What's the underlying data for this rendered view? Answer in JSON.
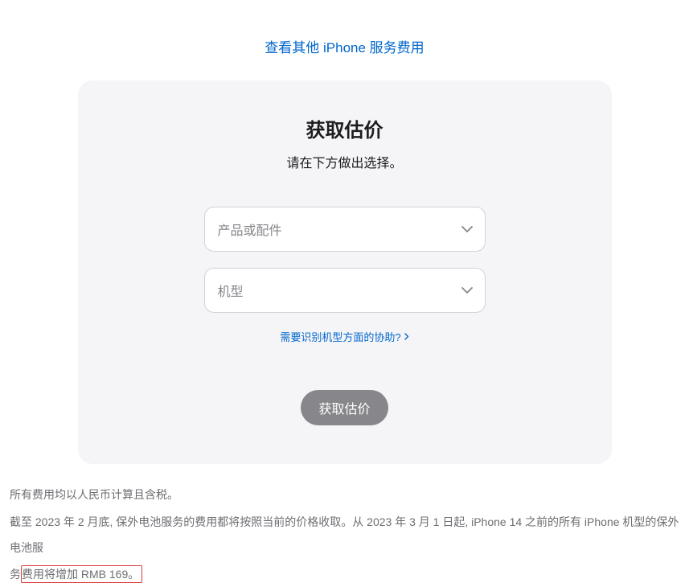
{
  "topLink": {
    "text": "查看其他 iPhone 服务费用"
  },
  "card": {
    "title": "获取估价",
    "subtitle": "请在下方做出选择。",
    "select1": {
      "placeholder": "产品或配件"
    },
    "select2": {
      "placeholder": "机型"
    },
    "helpLink": "需要识别机型方面的协助?",
    "button": "获取估价"
  },
  "footnotes": {
    "line1": "所有费用均以人民币计算且含税。",
    "line2_part1": "截至 2023 年 2 月底, 保外电池服务的费用都将按照当前的价格收取。从 2023 年 3 月 1 日起, iPhone 14 之前的所有 iPhone 机型的保外电池服",
    "line2_part2": "务",
    "line2_highlight": "费用将增加 RMB 169。"
  }
}
